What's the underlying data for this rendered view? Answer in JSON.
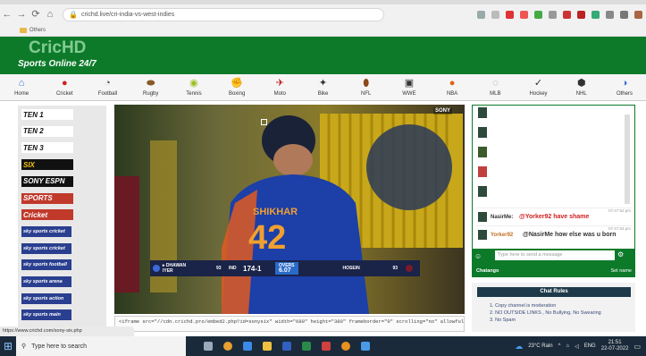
{
  "browser": {
    "url": "crichd.live/cri-india-vs-west-indies",
    "bookmarks_folder_label": "Others"
  },
  "site": {
    "logo": "CricHD",
    "tagline": "Sports Online 24/7"
  },
  "sports_nav": [
    {
      "label": "Home",
      "icon": "home-icon"
    },
    {
      "label": "Cricket",
      "icon": "cricket-ball-icon"
    },
    {
      "label": "Football",
      "icon": "football-icon"
    },
    {
      "label": "Rugby",
      "icon": "rugby-icon"
    },
    {
      "label": "Tennis",
      "icon": "tennis-icon"
    },
    {
      "label": "Boxing",
      "icon": "boxing-icon"
    },
    {
      "label": "Moto",
      "icon": "moto-icon"
    },
    {
      "label": "Bike",
      "icon": "bike-icon"
    },
    {
      "label": "NFL",
      "icon": "nfl-icon"
    },
    {
      "label": "WWE",
      "icon": "wwe-icon"
    },
    {
      "label": "NBA",
      "icon": "nba-icon"
    },
    {
      "label": "MLB",
      "icon": "mlb-icon"
    },
    {
      "label": "Hockey",
      "icon": "hockey-icon"
    },
    {
      "label": "NHL",
      "icon": "nhl-icon"
    },
    {
      "label": "Others",
      "icon": "others-icon"
    }
  ],
  "channels": [
    {
      "label": "TEN 1",
      "bg": "#ffffff",
      "fg": "#111111"
    },
    {
      "label": "TEN 2",
      "bg": "#ffffff",
      "fg": "#111111"
    },
    {
      "label": "TEN 3",
      "bg": "#ffffff",
      "fg": "#111111"
    },
    {
      "label": "SIX",
      "bg": "#111111",
      "fg": "#f4c20d"
    },
    {
      "label": "SONY ESPN",
      "bg": "#111111",
      "fg": "#ffffff"
    },
    {
      "label": "SPORTS",
      "bg": "#c0392b",
      "fg": "#ffffff"
    },
    {
      "label": "Cricket",
      "bg": "#c0392b",
      "fg": "#ffffff"
    },
    {
      "label": "sky sports cricket",
      "bg": "#2a3f8f",
      "fg": "#ffffff"
    },
    {
      "label": "sky sports cricket",
      "bg": "#2a3f8f",
      "fg": "#ffffff"
    },
    {
      "label": "sky sports football",
      "bg": "#2a3f8f",
      "fg": "#ffffff"
    },
    {
      "label": "sky sports arena",
      "bg": "#2a3f8f",
      "fg": "#ffffff"
    },
    {
      "label": "sky sports action",
      "bg": "#2a3f8f",
      "fg": "#ffffff"
    },
    {
      "label": "sky sports main",
      "bg": "#2a3f8f",
      "fg": "#ffffff"
    }
  ],
  "video": {
    "watermark": "SONY",
    "jersey_name": "SHIKHAR",
    "jersey_number": "42",
    "score_bar": {
      "batter1": "▸ DHAWAN",
      "batter1_score": "93",
      "batter2": "IYER",
      "team": "IND",
      "team_score": "174-1",
      "overs_label": "OVERS",
      "overs": "6.07",
      "bowler": "HOSEIN",
      "bowler_figures": "93"
    }
  },
  "embed_code": "<iframe src=\"//cdn.crichd.pro/embed2.php?id=sonysix\" width=\"680\" height=\"380\" frameborder=\"0\" scrolling=\"no\" allowfullscreen></iframe>",
  "chat": {
    "messages": [
      {
        "user": "NasirMe:",
        "text": "@Yorker92 have shame",
        "time": "07:47:52 pm"
      },
      {
        "user": "Yorker92",
        "text": "@NasirMe how else was u born",
        "time": "07:47:53 pm"
      }
    ],
    "input_placeholder": "Type here to send a message",
    "footer_left": "Chatango",
    "footer_right": "Set name",
    "rules_title": "Chat Rules",
    "rules": [
      "1. Copy channel is moderation",
      "2. NO OUTSIDE LINKS , No Bullying, No Swearing",
      "3. No Spam"
    ]
  },
  "taskbar": {
    "search_placeholder": "Type here to search",
    "weather": "23°C Rain",
    "lang": "ENG",
    "time": "21:51",
    "date": "22-07-2022"
  },
  "status_url": "https://www.crichd.com/sony-six.php"
}
